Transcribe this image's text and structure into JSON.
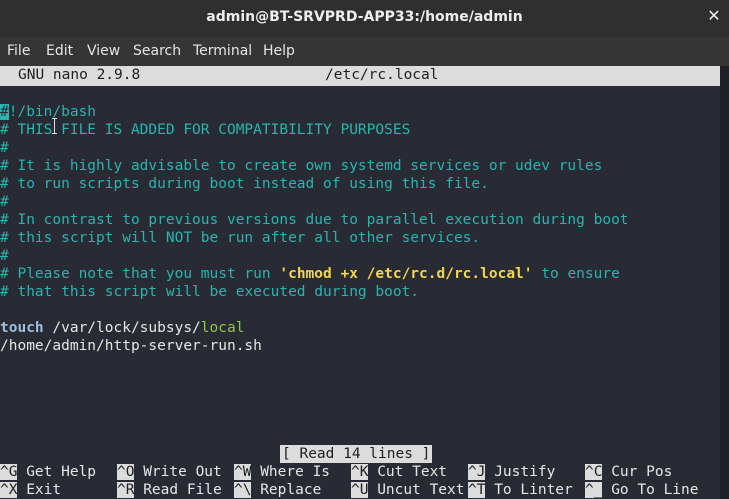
{
  "window": {
    "title": "admin@BT-SRVPRD-APP33:/home/admin",
    "close_glyph": "✕"
  },
  "menu": [
    "File",
    "Edit",
    "View",
    "Search",
    "Terminal",
    "Help"
  ],
  "nano": {
    "version": "GNU nano 2.9.8",
    "filename": "/etc/rc.local"
  },
  "file_lines": {
    "l1_hash": "#",
    "l1_rest": "!/bin/bash",
    "l2": "# THIS FILE IS ADDED FOR COMPATIBILITY PURPOSES",
    "l3": "#",
    "l4": "# It is highly advisable to create own systemd services or udev rules",
    "l5": "# to run scripts during boot instead of using this file.",
    "l6": "#",
    "l7": "# In contrast to previous versions due to parallel execution during boot",
    "l8": "# this script will NOT be run after all other services.",
    "l9": "#",
    "l10_a": "# Please note that you must run ",
    "l10_b": "'chmod +x /etc/rc.d/rc.local'",
    "l10_c": " to ensure",
    "l11": "# that this script will be executed during boot.",
    "l13_cmd": "touch",
    "l13_path": " /var/lock/subsys/",
    "l13_last": "local",
    "l14": "/home/admin/http-server-run.sh"
  },
  "status_message": "[ Read 14 lines ]",
  "shortcuts": [
    {
      "key": "^G",
      "label": " Get Help"
    },
    {
      "key": "^O",
      "label": " Write Out"
    },
    {
      "key": "^W",
      "label": " Where Is"
    },
    {
      "key": "^K",
      "label": " Cut Text"
    },
    {
      "key": "^J",
      "label": " Justify"
    },
    {
      "key": "^C",
      "label": " Cur Pos"
    },
    {
      "key": "^X",
      "label": " Exit"
    },
    {
      "key": "^R",
      "label": " Read File"
    },
    {
      "key": "^\\",
      "label": " Replace"
    },
    {
      "key": "^U",
      "label": " Uncut Text"
    },
    {
      "key": "^T",
      "label": " To Linter"
    },
    {
      "key": "^_",
      "label": " Go To Line"
    }
  ]
}
